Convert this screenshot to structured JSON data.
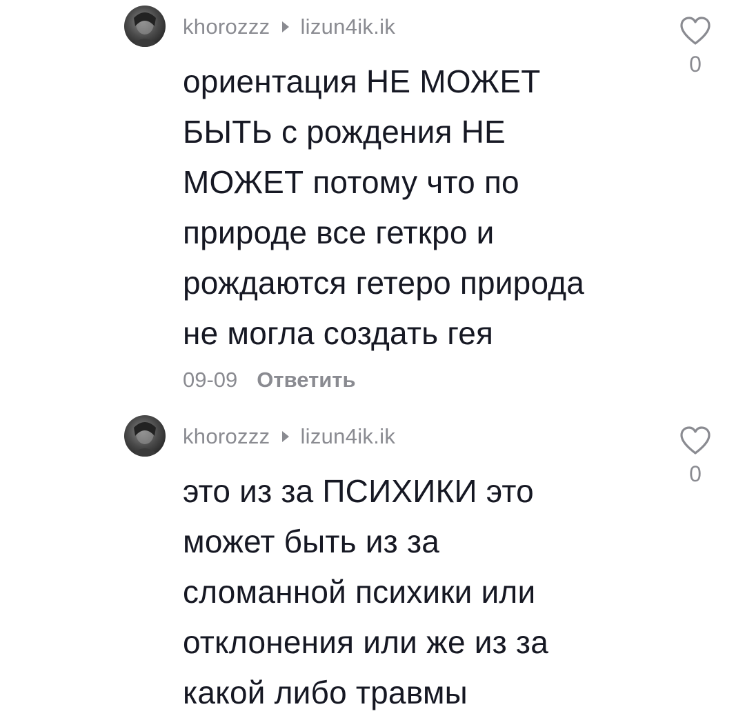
{
  "comments": [
    {
      "username": "khorozzz",
      "reply_to": "lizun4ik.ik",
      "text": "ориентация НЕ МОЖЕТ\nБЫТЬ с рождения НЕ\nМОЖЕТ потому что по\nприроде все геткро и\nрождаются гетеро природа\nне могла создать гея",
      "date": "09-09",
      "reply_label": "Ответить",
      "likes": "0",
      "avatar_icon": "user-avatar",
      "like_icon": "heart-icon"
    },
    {
      "username": "khorozzz",
      "reply_to": "lizun4ik.ik",
      "text": "это из за ПСИХИКИ это\nможет быть из за\nсломанной психики или\nотклонения или же из за\nкакой либо травмы",
      "likes": "0",
      "avatar_icon": "user-avatar",
      "like_icon": "heart-icon"
    }
  ],
  "colors": {
    "primary_text": "#161823",
    "secondary_text": "#8a8b91",
    "background": "#ffffff"
  }
}
